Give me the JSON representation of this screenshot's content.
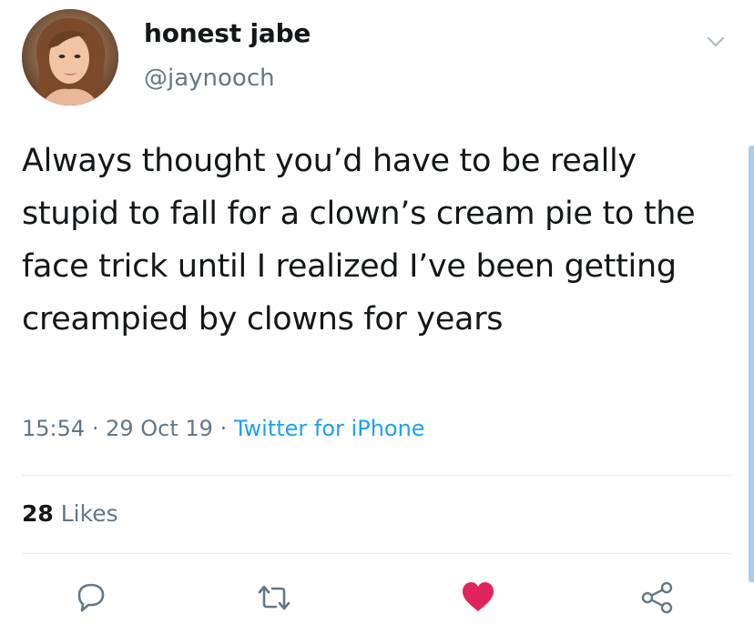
{
  "tweet": {
    "author": {
      "display_name": "honest jabe",
      "handle": "@jaynooch"
    },
    "text": "Always thought you’d have to be really stupid to fall for a clown’s cream pie to the face trick until I realized I’ve been getting creampied by clowns for years",
    "meta": {
      "time": "15:54",
      "separator": "·",
      "date": "29 Oct 19",
      "source": "Twitter for iPhone"
    },
    "likes": {
      "count": "28",
      "label": "Likes"
    },
    "actions": {
      "reply_icon": "reply-icon",
      "retweet_icon": "retweet-icon",
      "like_icon": "heart-icon",
      "share_icon": "share-icon"
    }
  },
  "colors": {
    "text": "#14171a",
    "secondary": "#657786",
    "link": "#1da1f2",
    "like": "#e0245e",
    "divider": "#e6ecf0"
  }
}
